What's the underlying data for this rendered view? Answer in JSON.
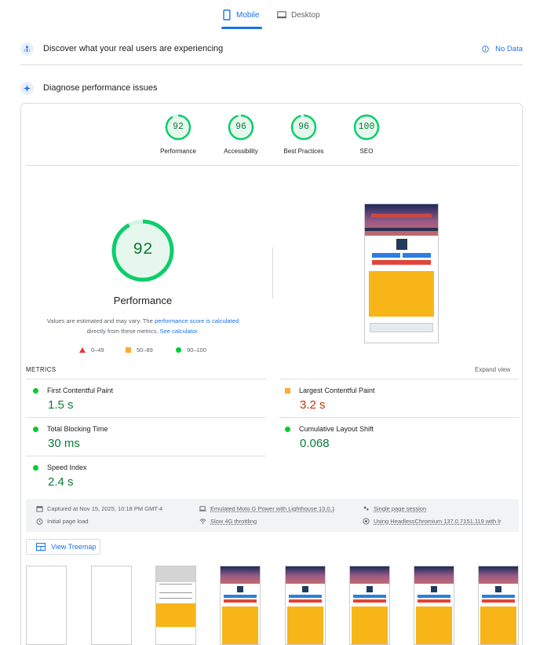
{
  "tabs": {
    "mobile": "Mobile",
    "desktop": "Desktop"
  },
  "field_data": {
    "title": "Discover what your real users are experiencing",
    "status": "No Data"
  },
  "diagnose": {
    "title": "Diagnose performance issues"
  },
  "categories": [
    {
      "score": "92",
      "label": "Performance"
    },
    {
      "score": "96",
      "label": "Accessibility"
    },
    {
      "score": "96",
      "label": "Best Practices"
    },
    {
      "score": "100",
      "label": "SEO"
    }
  ],
  "main_score": {
    "score": "92",
    "label": "Performance",
    "note_prefix": "Values are estimated and may vary. The ",
    "note_link1": "performance score is calculated",
    "note_mid": " directly from these metrics. ",
    "note_link2": "See calculator."
  },
  "legend": {
    "poor": "0–49",
    "average": "50–89",
    "good": "90–100"
  },
  "metrics": {
    "heading": "METRICS",
    "expand": "Expand view",
    "items": {
      "fcp": {
        "label": "First Contentful Paint",
        "value": "1.5 s"
      },
      "lcp": {
        "label": "Largest Contentful Paint",
        "value": "3.2 s"
      },
      "tbt": {
        "label": "Total Blocking Time",
        "value": "30 ms"
      },
      "cls": {
        "label": "Cumulative Layout Shift",
        "value": "0.068"
      },
      "si": {
        "label": "Speed Index",
        "value": "2.4 s"
      }
    }
  },
  "run_info": {
    "captured": "Captured at Nov 15, 2025, 10:18 PM GMT-4",
    "load": "Initial page load",
    "device": "Emulated Moto G Power with Lighthouse 13.0.1",
    "throttle": "Slow 4G throttling",
    "session": "Single page session",
    "browser": "Using HeadlessChromium 137.0.7151.119 with lr"
  },
  "treemap": {
    "label": "View Treemap"
  },
  "colors": {
    "accent": "#1a73e8",
    "good": "#0cce6b",
    "good_text": "#0c7a36",
    "average": "#ffa400",
    "poor": "#ff4e42",
    "lcp_value": "#c33300"
  },
  "gauge_fractions": {
    "main": 0.92,
    "categories": [
      0.92,
      0.96,
      0.96,
      1.0
    ]
  }
}
